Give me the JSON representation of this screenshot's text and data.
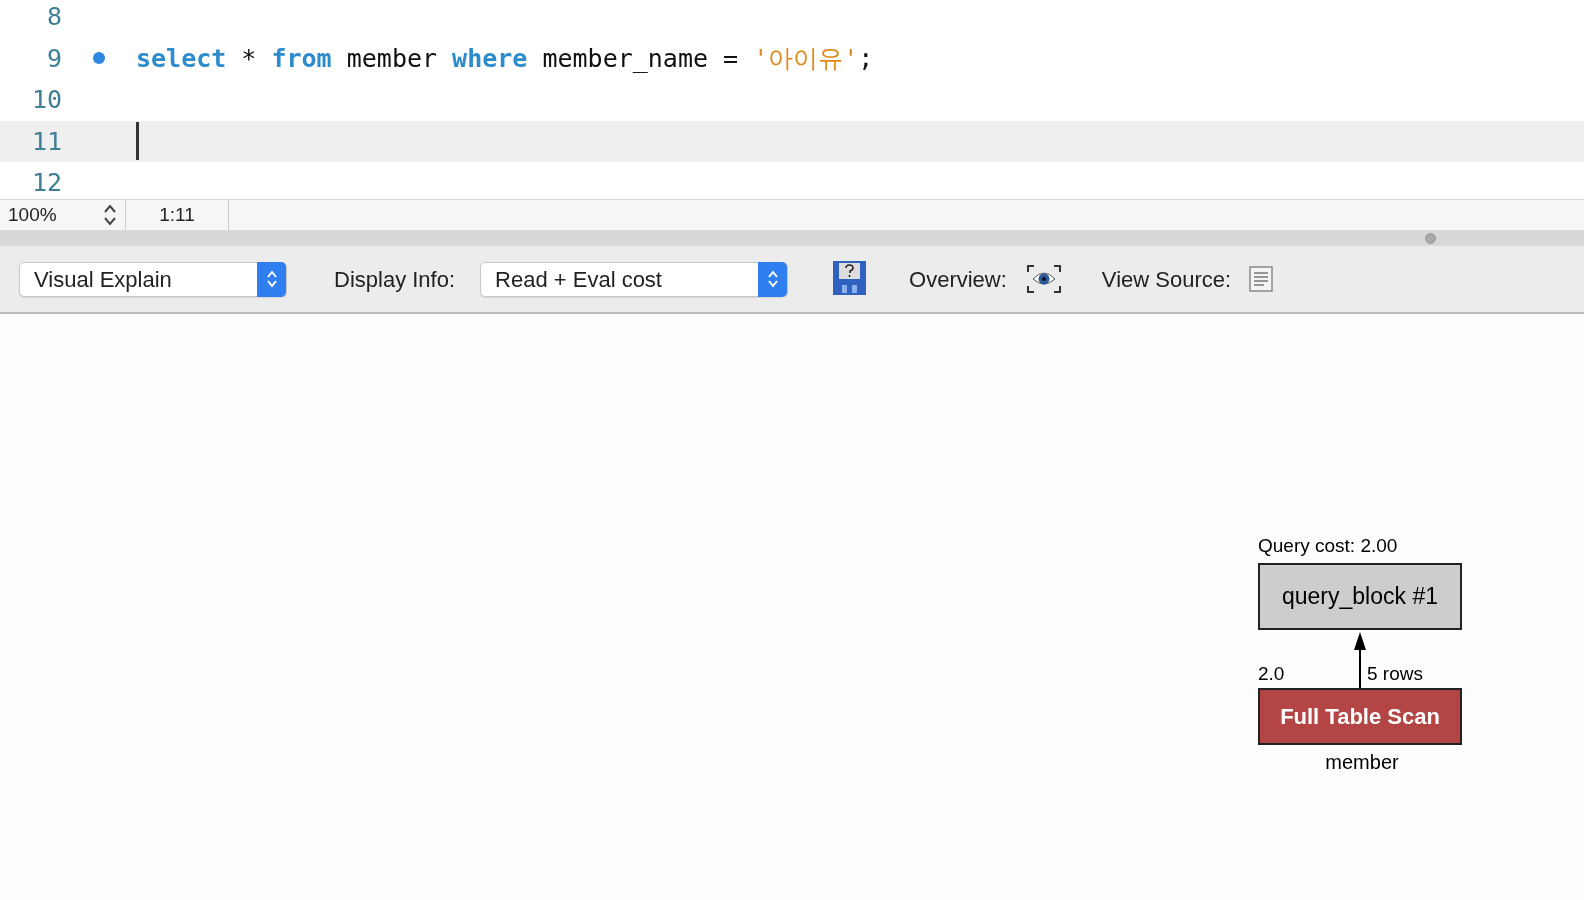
{
  "editor": {
    "lines": [
      {
        "number": "8",
        "breakpoint": false,
        "current": false
      },
      {
        "number": "9",
        "breakpoint": true,
        "current": false,
        "tokens": [
          {
            "kind": "keyword",
            "text": "select"
          },
          {
            "kind": "plain",
            "text": " * "
          },
          {
            "kind": "keyword",
            "text": "from"
          },
          {
            "kind": "plain",
            "text": " member "
          },
          {
            "kind": "keyword",
            "text": "where"
          },
          {
            "kind": "plain",
            "text": " member_name = "
          },
          {
            "kind": "string",
            "text": "'아이유'"
          },
          {
            "kind": "plain",
            "text": ";"
          }
        ]
      },
      {
        "number": "10",
        "breakpoint": false,
        "current": false
      },
      {
        "number": "11",
        "breakpoint": false,
        "current": true
      },
      {
        "number": "12",
        "breakpoint": false,
        "current": false
      }
    ]
  },
  "status_bar": {
    "zoom": "100%",
    "position": "1:11"
  },
  "toolbar": {
    "view_select": "Visual Explain",
    "display_info_label": "Display Info:",
    "display_info_select": "Read + Eval cost",
    "overview_label": "Overview:",
    "view_source_label": "View Source:"
  },
  "diagram": {
    "query_cost": "Query cost: 2.00",
    "query_block": "query_block #1",
    "cost": "2.0",
    "rows": "5 rows",
    "access_type": "Full Table Scan",
    "table": "member"
  }
}
